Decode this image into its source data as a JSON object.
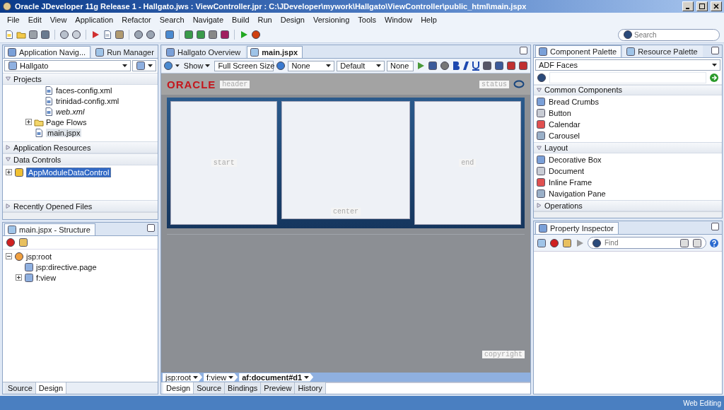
{
  "window": {
    "title": "Oracle JDeveloper 11g Release 1 - Hallgato.jws : ViewController.jpr : C:\\JDeveloper\\mywork\\Hallgato\\ViewController\\public_html\\main.jspx"
  },
  "menu": [
    "File",
    "Edit",
    "View",
    "Application",
    "Refactor",
    "Search",
    "Navigate",
    "Build",
    "Run",
    "Design",
    "Versioning",
    "Tools",
    "Window",
    "Help"
  ],
  "toolbar_search": {
    "placeholder": "Search"
  },
  "navigator": {
    "tabs": [
      {
        "label": "Application Navig...",
        "selected": true
      },
      {
        "label": "Run Manager",
        "selected": false
      }
    ],
    "application": "Hallgato",
    "projects": {
      "title": "Projects",
      "expanded": true,
      "tree": [
        {
          "kind": "group",
          "children": [
            {
              "kind": "leaf",
              "label": "faces-config.xml",
              "italic": false,
              "selected": false
            },
            {
              "kind": "leaf",
              "label": "trinidad-config.xml",
              "italic": false,
              "selected": false
            },
            {
              "kind": "leaf",
              "label": "web.xml",
              "italic": true,
              "selected": false
            }
          ]
        },
        {
          "kind": "folder",
          "label": "Page Flows",
          "expanded": false,
          "italic": false,
          "selected": false
        },
        {
          "kind": "leaf",
          "label": "main.jspx",
          "italic": false,
          "selected": true
        }
      ]
    },
    "resources": {
      "title": "Application Resources",
      "expanded": false
    },
    "data_controls": {
      "title": "Data Controls",
      "expanded": true,
      "items": [
        {
          "label": "AppModuleDataControl",
          "expanded": false,
          "selected": true
        }
      ]
    },
    "recent": {
      "title": "Recently Opened Files",
      "expanded": false
    }
  },
  "structure": {
    "tab": "main.jspx - Structure",
    "tree": [
      {
        "kind": "node",
        "label": "jsp:root",
        "expanded": true,
        "children": [
          {
            "kind": "leaf",
            "label": "jsp:directive.page"
          },
          {
            "kind": "node",
            "label": "f:view",
            "expanded": false
          }
        ]
      }
    ],
    "tabs": [
      {
        "label": "Source",
        "selected": false
      },
      {
        "label": "Design",
        "selected": true
      }
    ]
  },
  "editor": {
    "tabs": [
      {
        "label": "Hallgato Overview",
        "selected": false
      },
      {
        "label": "main.jspx",
        "selected": true
      }
    ],
    "show": "Show",
    "dropdowns": [
      "Full Screen Size",
      "None",
      "Default",
      "None"
    ],
    "canvas": {
      "logo": "ORACLE",
      "header_label": "header",
      "status_label": "status",
      "columns": [
        "start",
        "center",
        "end"
      ],
      "footer_label": "copyright"
    },
    "breadcrumbs": [
      {
        "label": "jsp:root",
        "selected": false
      },
      {
        "label": "f:view",
        "selected": false
      },
      {
        "label": "af:document#d1",
        "selected": true
      }
    ],
    "bottom_tabs": [
      {
        "label": "Design",
        "selected": true
      },
      {
        "label": "Source",
        "selected": false
      },
      {
        "label": "Bindings",
        "selected": false
      },
      {
        "label": "Preview",
        "selected": false
      },
      {
        "label": "History",
        "selected": false
      }
    ]
  },
  "palette": {
    "tabs": [
      {
        "label": "Component Palette",
        "selected": true
      },
      {
        "label": "Resource Palette",
        "selected": false
      }
    ],
    "library": "ADF Faces",
    "sections": [
      {
        "title": "Common Components",
        "expanded": true,
        "items": [
          "Bread Crumbs",
          "Button",
          "Calendar",
          "Carousel"
        ]
      },
      {
        "title": "Layout",
        "expanded": true,
        "items": [
          "Decorative Box",
          "Document",
          "Inline Frame",
          "Navigation Pane"
        ]
      },
      {
        "title": "Operations",
        "expanded": false
      }
    ]
  },
  "inspector": {
    "tab": "Property Inspector",
    "find": {
      "placeholder": "Find"
    }
  },
  "status_bar": {
    "mode": "Web Editing"
  }
}
